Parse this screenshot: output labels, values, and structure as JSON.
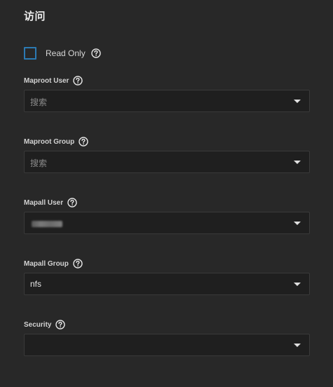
{
  "section": {
    "title": "访问"
  },
  "read_only": {
    "label": "Read Only",
    "checked": false
  },
  "fields": {
    "maproot_user": {
      "label": "Maproot User",
      "placeholder": "搜索",
      "value": ""
    },
    "maproot_group": {
      "label": "Maproot Group",
      "placeholder": "搜索",
      "value": ""
    },
    "mapall_user": {
      "label": "Mapall User",
      "value_obscured": true
    },
    "mapall_group": {
      "label": "Mapall Group",
      "value": "nfs"
    },
    "security": {
      "label": "Security",
      "value": ""
    }
  },
  "colors": {
    "background": "#282828",
    "field_background": "#1f1f1f",
    "checkbox_border": "#2c7ab3",
    "text": "#e6e6e6"
  },
  "icons": {
    "help": "help-circle-icon",
    "dropdown": "chevron-down-icon"
  }
}
